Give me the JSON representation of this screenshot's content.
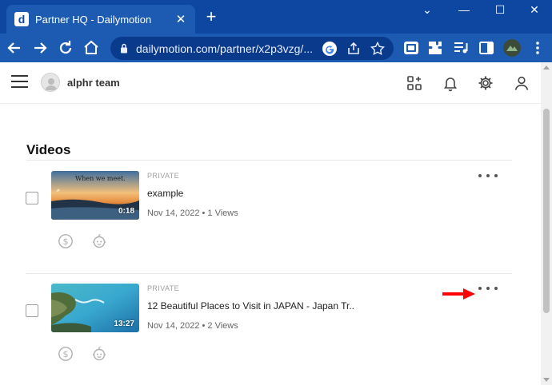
{
  "browser": {
    "tab_title": "Partner HQ - Dailymotion",
    "favicon_letter": "d",
    "url": "dailymotion.com/partner/x2p3vzg/..."
  },
  "app": {
    "team_name": "alphr team",
    "section_title": "Videos"
  },
  "videos": [
    {
      "privacy": "PRIVATE",
      "title": "example",
      "meta": "Nov 14, 2022 • 1 Views",
      "duration": "0:18",
      "thumb_caption": "When we meet."
    },
    {
      "privacy": "PRIVATE",
      "title": "12 Beautiful Places to Visit in JAPAN - Japan Tr..",
      "meta": "Nov 14, 2022 • 2 Views",
      "duration": "13:27"
    }
  ],
  "colors": {
    "browser_frame": "#0d47a1",
    "browser_toolbar": "#1d5bb3",
    "annotation_arrow": "#ff0000"
  }
}
